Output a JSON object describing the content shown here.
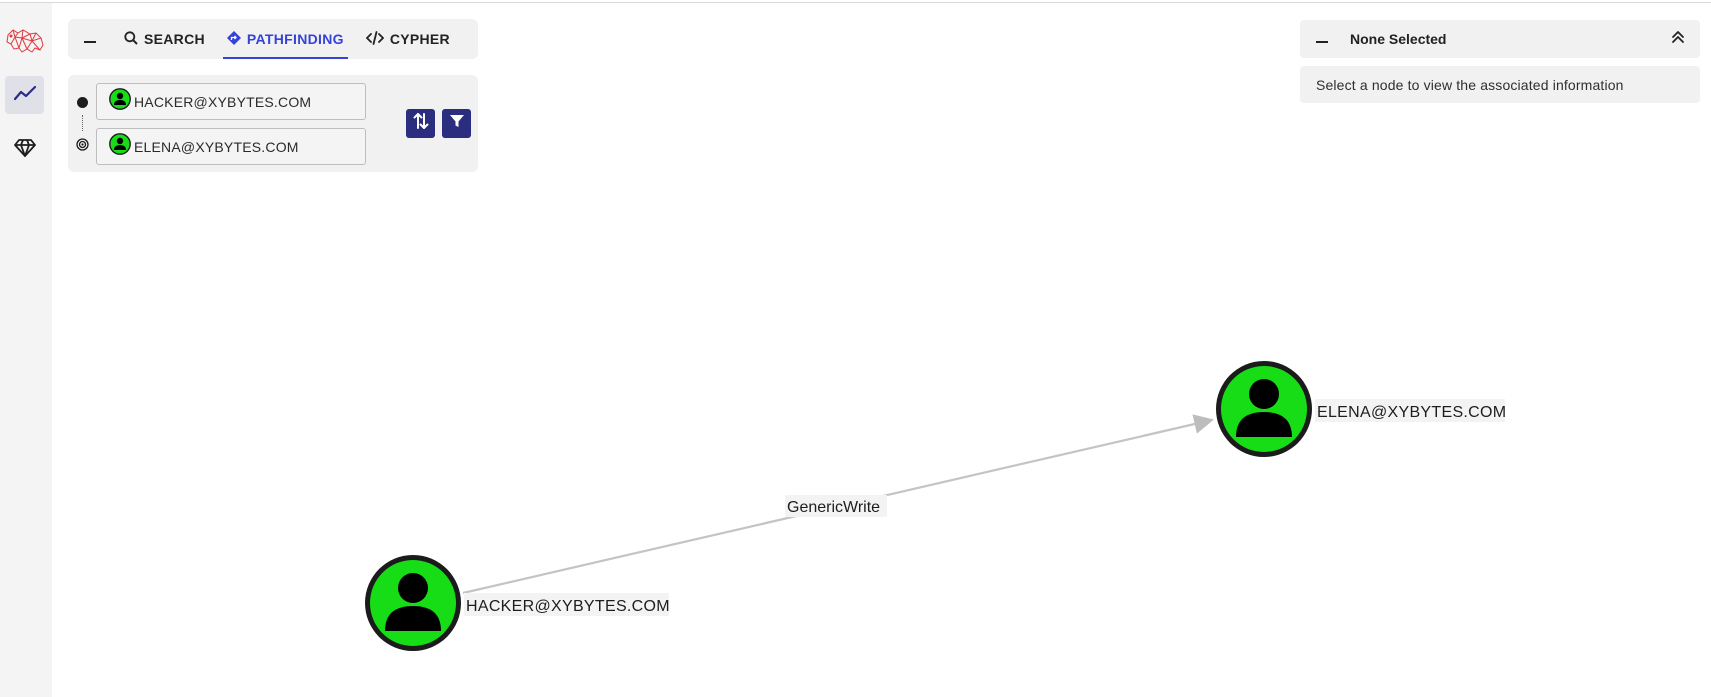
{
  "tabs": [
    {
      "label": "SEARCH",
      "icon": "search-icon",
      "active": false
    },
    {
      "label": "PATHFINDING",
      "icon": "pathfinding-icon",
      "active": true
    },
    {
      "label": "CYPHER",
      "icon": "code-icon",
      "active": false
    }
  ],
  "pathfinding": {
    "start_value": "HACKER@XYBYTES.COM",
    "end_value": "ELENA@XYBYTES.COM"
  },
  "info_panel": {
    "title": "None Selected",
    "message": "Select a node to view the associated information"
  },
  "graph": {
    "nodes": [
      {
        "id": "hacker",
        "label": "HACKER@XYBYTES.COM",
        "type": "user",
        "color": "#17dd17"
      },
      {
        "id": "elena",
        "label": "ELENA@XYBYTES.COM",
        "type": "user",
        "color": "#17dd17"
      }
    ],
    "edges": [
      {
        "from": "hacker",
        "to": "elena",
        "label": "GenericWrite"
      }
    ]
  },
  "colors": {
    "accent": "#3542d8",
    "button_bg": "#2b2e7e",
    "user_node": "#17dd17",
    "logo": "#e0393e"
  }
}
